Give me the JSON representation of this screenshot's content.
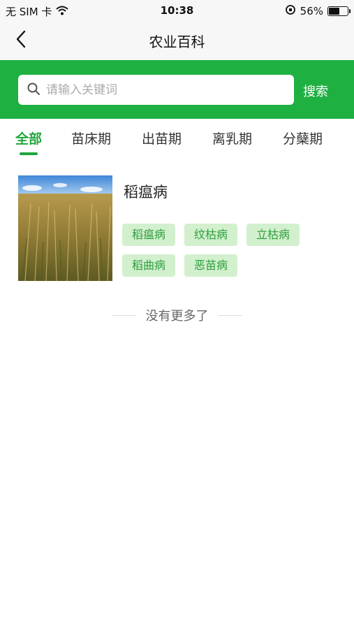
{
  "status_bar": {
    "carrier": "无 SIM 卡",
    "time": "10:38",
    "battery_percent_label": "56%",
    "battery_level": 0.56,
    "icons": [
      "wifi-icon",
      "orientation-lock-icon",
      "battery-icon"
    ]
  },
  "nav": {
    "title": "农业百科",
    "back_icon": "chevron-left-icon"
  },
  "search": {
    "placeholder": "请输入关键词",
    "button_label": "搜索",
    "icon": "search-icon"
  },
  "tabs": [
    {
      "label": "全部",
      "active": true
    },
    {
      "label": "苗床期",
      "active": false
    },
    {
      "label": "出苗期",
      "active": false
    },
    {
      "label": "离乳期",
      "active": false
    },
    {
      "label": "分蘖期",
      "active": false
    }
  ],
  "results": [
    {
      "title": "稻瘟病",
      "image": "rice-field-photo",
      "tags": [
        "稻瘟病",
        "纹枯病",
        "立枯病",
        "稻曲病",
        "恶苗病"
      ]
    }
  ],
  "list_end_text": "没有更多了",
  "colors": {
    "brand_green": "#1fb042",
    "tab_active": "#1fa63c",
    "tag_bg": "#d2f0cd",
    "tag_text": "#2e9e3f"
  }
}
